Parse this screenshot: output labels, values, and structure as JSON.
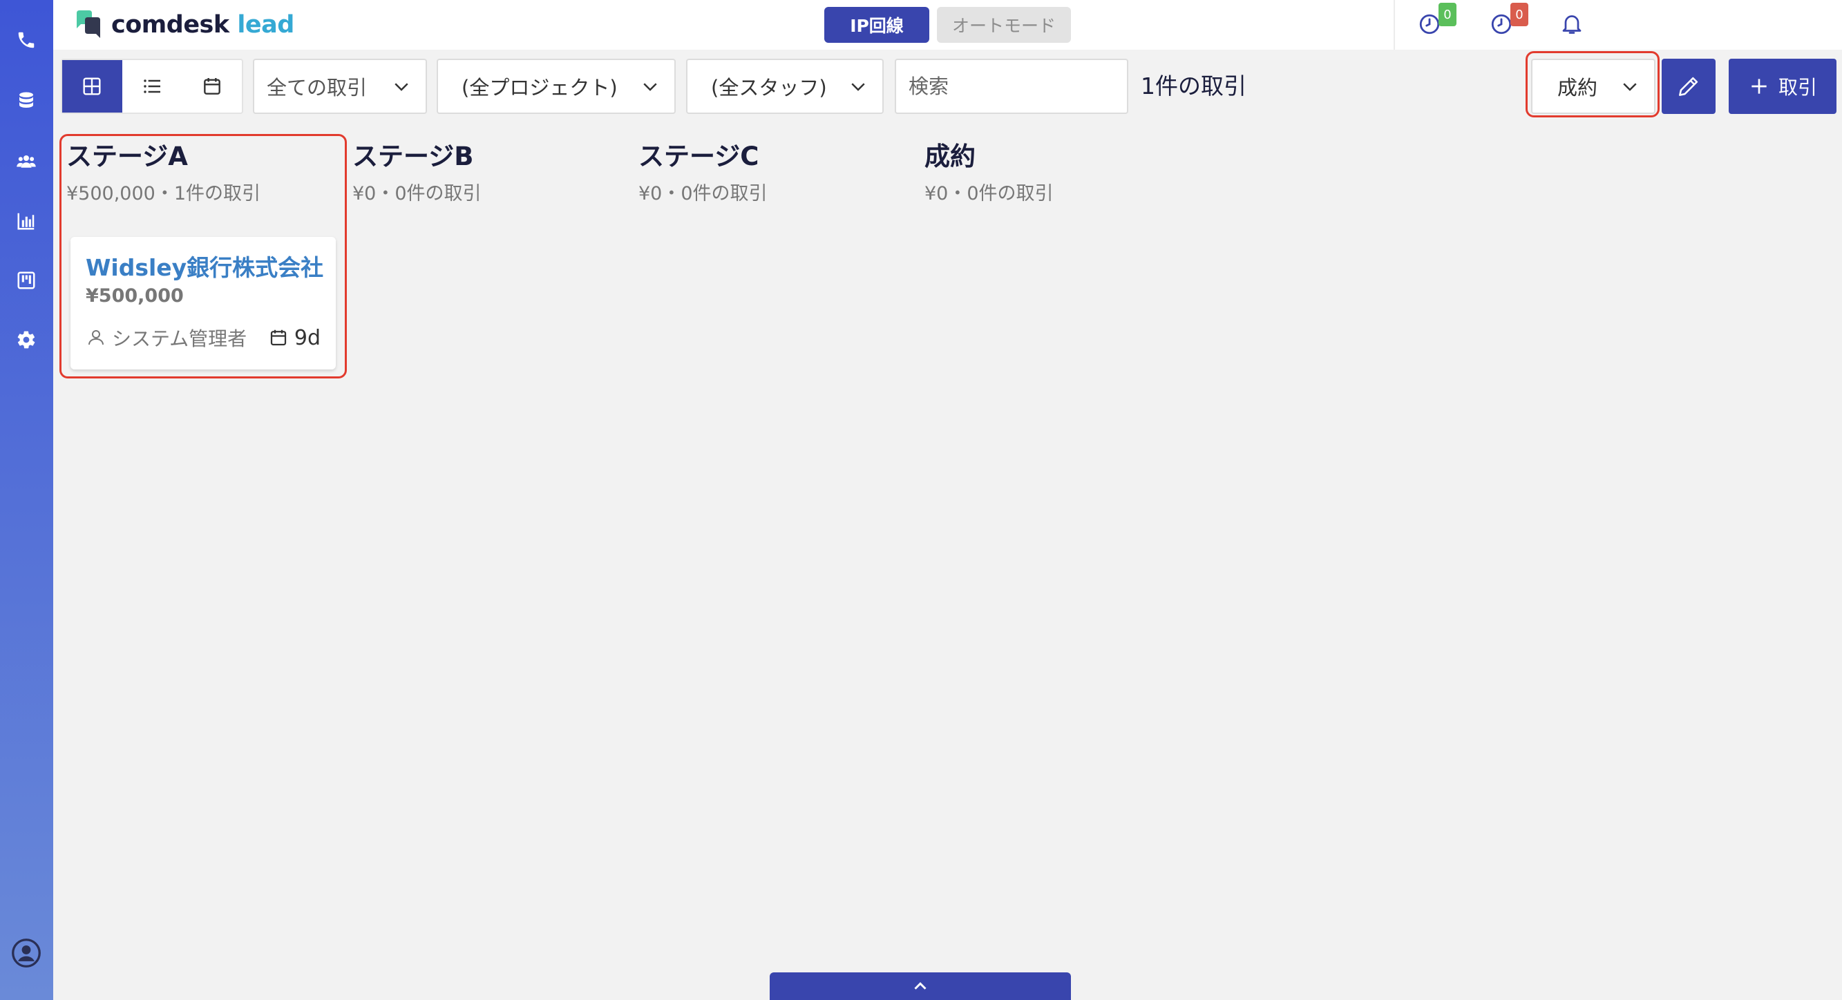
{
  "app": {
    "logo_main": "comdesk",
    "logo_accent": "lead"
  },
  "header": {
    "mode_ip": "IP回線",
    "mode_auto": "オートモード",
    "badge_green": "0",
    "badge_red": "0"
  },
  "sidebar": {
    "icons": [
      "phone-icon",
      "database-icon",
      "users-icon",
      "chart-icon",
      "kanban-icon",
      "gear-icon",
      "account-icon"
    ]
  },
  "toolbar": {
    "views": [
      "grid-view",
      "list-view",
      "calendar-view"
    ],
    "deal_filter": "全ての取引",
    "project_filter": "(全プロジェクト)",
    "staff_filter": "(全スタッフ)",
    "search_placeholder": "検索",
    "deal_count": "1件の取引",
    "stage_filter": "成約",
    "add_label": "取引"
  },
  "board": {
    "columns": [
      {
        "title": "ステージA",
        "summary": "¥500,000・1件の取引"
      },
      {
        "title": "ステージB",
        "summary": "¥0・0件の取引"
      },
      {
        "title": "ステージC",
        "summary": "¥0・0件の取引"
      },
      {
        "title": "成約",
        "summary": "¥0・0件の取引"
      }
    ],
    "card": {
      "title": "Widsley銀行株式会社",
      "amount": "¥500,000",
      "owner": "システム管理者",
      "age": "9d"
    }
  },
  "colors": {
    "primary": "#3945ad",
    "sidebar_top": "#3e56d6",
    "highlight": "#e23b2e",
    "card_title": "#3a7fc5",
    "logo_accent": "#35a9d4"
  }
}
